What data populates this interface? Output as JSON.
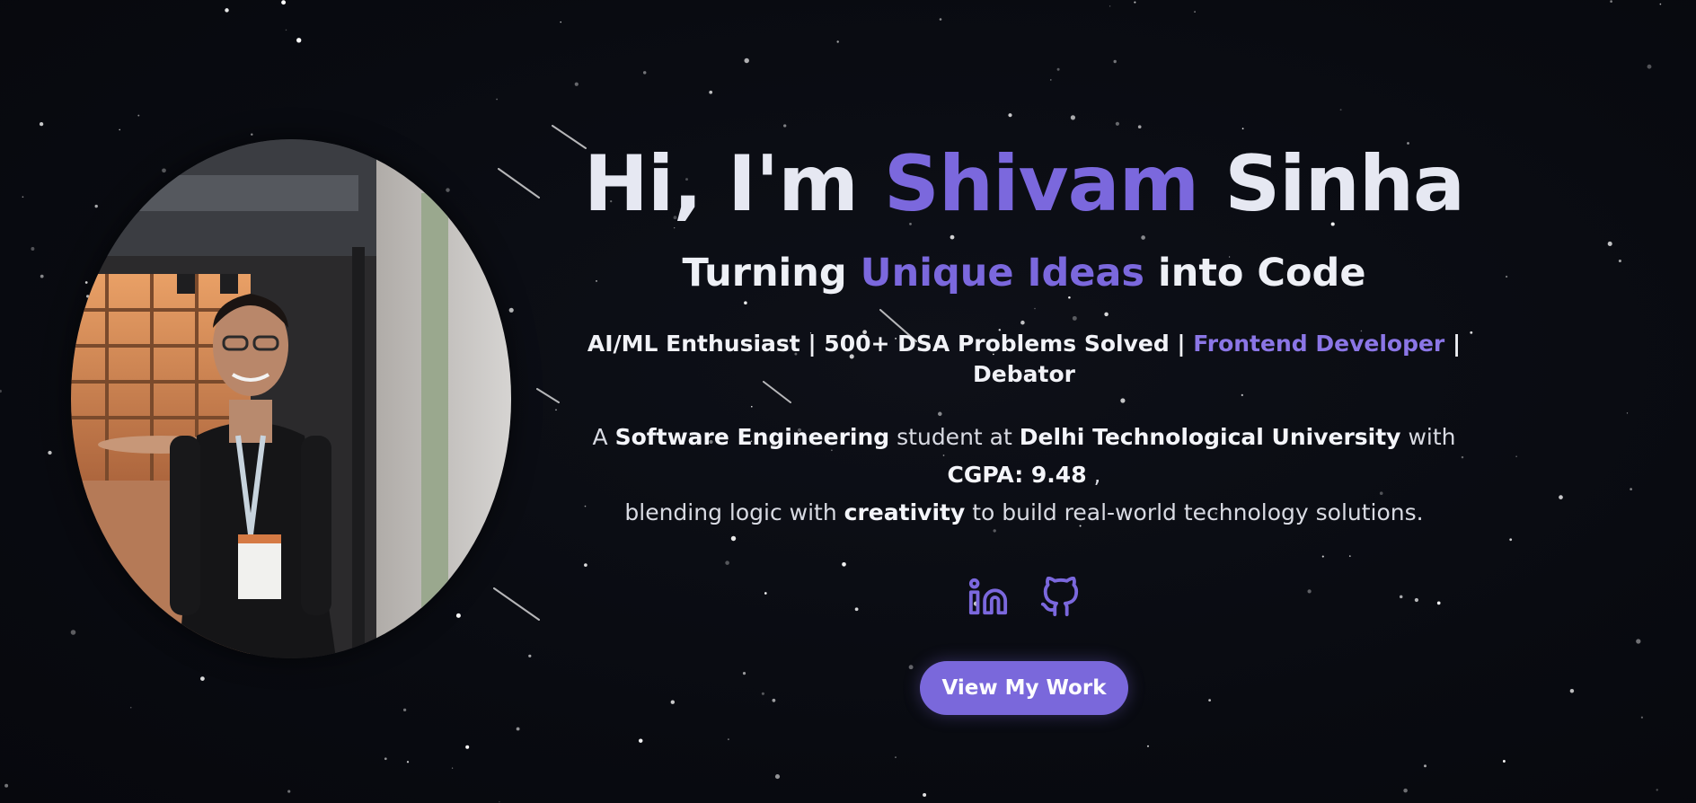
{
  "hero": {
    "title_prefix": "Hi, I'm",
    "title_first": "Shivam",
    "title_last": "Sinha",
    "tagline_prefix": "Turning",
    "tagline_accent": "Unique Ideas",
    "tagline_suffix": "into Code",
    "roles_lead": "AI/ML Enthusiast | 500+ DSA Problems Solved |",
    "roles_accent": "Frontend Developer",
    "roles_tail": "| Debator",
    "desc_a": "A",
    "desc_b": "Software Engineering",
    "desc_c": "student at",
    "desc_d": "Delhi Technological University",
    "desc_e": "with",
    "desc_f": "CGPA: 9.48",
    "desc_g": ",",
    "desc_h": "blending logic with",
    "desc_i": "creativity",
    "desc_j": "to build real-world technology solutions.",
    "cta_label": "View My Work"
  },
  "socials": [
    {
      "icon": "linkedin-icon"
    },
    {
      "icon": "github-icon"
    }
  ],
  "colors": {
    "accent": "#7b68dd",
    "background": "#0a0c12",
    "text": "#e6e8f2"
  }
}
